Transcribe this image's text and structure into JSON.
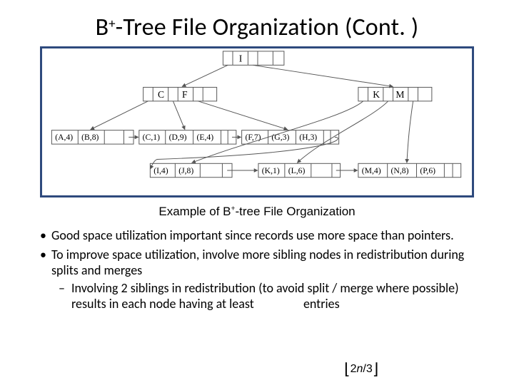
{
  "title_pre": "B",
  "title_sup": "+",
  "title_post": "-Tree File Organization (Cont. )",
  "caption_pre": "Example of B",
  "caption_sup": "+",
  "caption_post": "-tree File Organization",
  "bullets": [
    "Good space utilization important since records use more space than pointers.",
    "To improve space utilization, involve more sibling nodes in redistribution during splits and merges"
  ],
  "sub_bullet_pre": "Involving 2 siblings in redistribution (to avoid split / merge where possible) results in each node having at least",
  "sub_bullet_tail": "entries",
  "formula": {
    "lfloor": "⌊",
    "numer": "2",
    "var": "n",
    "denom": "3",
    "rfloor": "⌋"
  },
  "tree": {
    "root": [
      "",
      "I",
      "",
      ""
    ],
    "mid_left": [
      "C",
      "F",
      "",
      ""
    ],
    "mid_right": [
      "",
      "K",
      "M",
      ""
    ],
    "leaves": [
      [
        "(A,4)",
        "(B,8)",
        ""
      ],
      [
        "(C,1)",
        "(D,9)",
        "(E,4)"
      ],
      [
        "(F,7)",
        "(G,3)",
        "(H,3)"
      ],
      [
        "(I,4)",
        "(J,8)",
        ""
      ],
      [
        "(K,1)",
        "(L,6)",
        ""
      ],
      [
        "(M,4)",
        "(N,8)",
        "(P,6)"
      ]
    ]
  }
}
